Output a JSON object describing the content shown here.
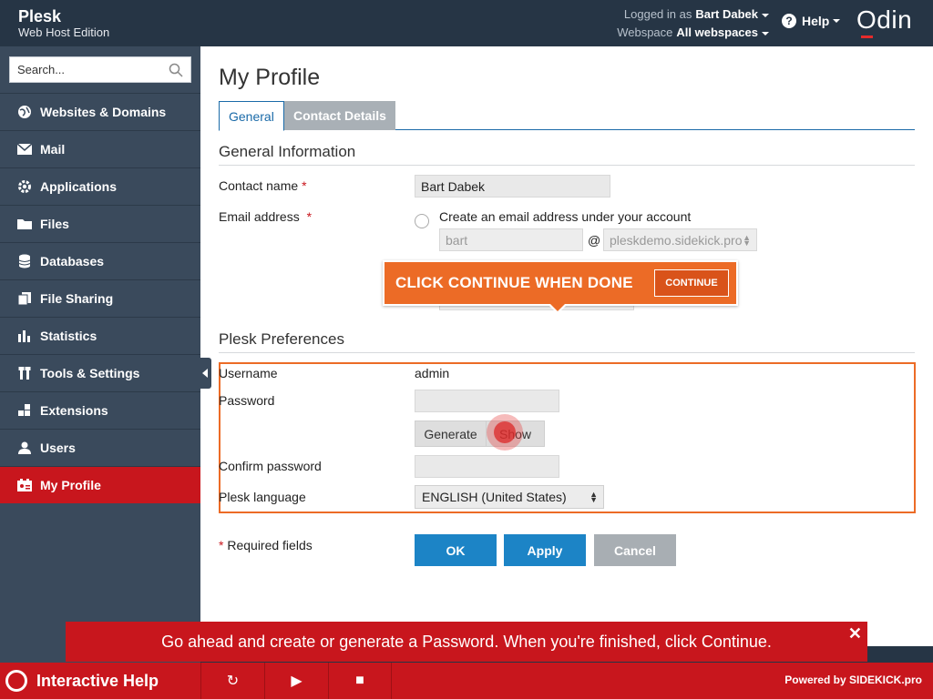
{
  "brand": {
    "name": "Plesk",
    "edition": "Web Host Edition",
    "logo": "Odin"
  },
  "header": {
    "logged_in_label": "Logged in as",
    "user": "Bart Dabek",
    "webspace_label": "Webspace",
    "webspace": "All webspaces",
    "help": "Help"
  },
  "search": {
    "placeholder": "Search..."
  },
  "sidebar": {
    "items": [
      {
        "label": "Websites & Domains"
      },
      {
        "label": "Mail"
      },
      {
        "label": "Applications"
      },
      {
        "label": "Files"
      },
      {
        "label": "Databases"
      },
      {
        "label": "File Sharing"
      },
      {
        "label": "Statistics"
      },
      {
        "label": "Tools & Settings"
      },
      {
        "label": "Extensions"
      },
      {
        "label": "Users"
      },
      {
        "label": "My Profile"
      }
    ]
  },
  "page": {
    "title": "My Profile",
    "tabs": [
      {
        "label": "General"
      },
      {
        "label": "Contact Details"
      }
    ]
  },
  "general_info": {
    "heading": "General Information",
    "contact_label": "Contact name",
    "required_mark": "*",
    "contact_value": "Bart Dabek",
    "email_label": "Email address",
    "email_option": "Create an email address under your account",
    "email_local": "bart",
    "at": "@",
    "email_domain": "pleskdemo.sidekick.pro"
  },
  "callout": {
    "text": "CLICK CONTINUE WHEN DONE",
    "button": "CONTINUE"
  },
  "preferences": {
    "heading": "Plesk Preferences",
    "username_label": "Username",
    "username_value": "admin",
    "password_label": "Password",
    "generate": "Generate",
    "show": "Show",
    "confirm_label": "Confirm password",
    "language_label": "Plesk language",
    "language_value": "ENGLISH (United States)"
  },
  "form": {
    "required_note": "Required fields",
    "ok": "OK",
    "apply": "Apply",
    "cancel": "Cancel"
  },
  "overlay": {
    "message": "Go ahead and create or generate a Password. When you're finished, click Continue.",
    "close": "✕"
  },
  "bottom_bar": {
    "title": "Interactive Help",
    "restart": "↻",
    "play": "▶",
    "stop": "■",
    "powered": "Powered by SIDEKICK.pro"
  },
  "colors": {
    "accent_red": "#c8161d",
    "accent_orange": "#ec6b26",
    "primary_blue": "#1c84c6",
    "sidebar": "#3a4a5c"
  }
}
